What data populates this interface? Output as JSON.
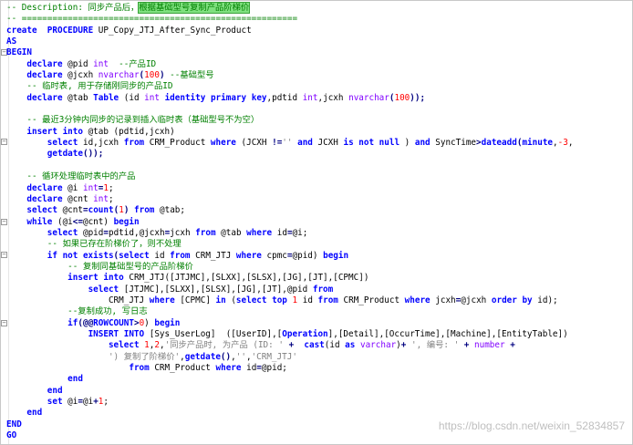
{
  "editor": {
    "watermark": "https://blog.csdn.net/weixin_52834857",
    "colors": {
      "keyword": "#0000ff",
      "comment": "#008000",
      "type": "#8000ff",
      "number": "#ff0000",
      "string": "#808080",
      "highlight": "#7fe07f"
    },
    "lines": [
      [
        [
          "c",
          "-- Description: 同步产品后，"
        ],
        [
          "c hl",
          "根据基础型号复制产品阶梯价"
        ]
      ],
      [
        [
          "c",
          "-- ======================================================"
        ]
      ],
      [
        [
          "k",
          "create"
        ],
        [
          "",
          "  "
        ],
        [
          "k",
          "PROCEDURE"
        ],
        [
          "",
          " UP_Copy_JTJ_After_Sync_Product"
        ]
      ],
      [
        [
          "k",
          "AS"
        ]
      ],
      [
        [
          "k",
          "BEGIN"
        ]
      ],
      [
        [
          "",
          "    "
        ],
        [
          "k",
          "declare"
        ],
        [
          "",
          " @pid "
        ],
        [
          "t",
          "int"
        ],
        [
          "c",
          "  --产品ID"
        ]
      ],
      [
        [
          "",
          "    "
        ],
        [
          "k",
          "declare"
        ],
        [
          "",
          " @jcxh "
        ],
        [
          "t",
          "nvarchar"
        ],
        [
          "p",
          "("
        ],
        [
          "n",
          "100"
        ],
        [
          "p",
          ")"
        ],
        [
          "c",
          " --基础型号"
        ]
      ],
      [
        [
          "",
          "    "
        ],
        [
          "c",
          "-- 临时表, 用于存储刚同步的产品ID"
        ]
      ],
      [
        [
          "",
          "    "
        ],
        [
          "k",
          "declare"
        ],
        [
          "",
          " @tab "
        ],
        [
          "k",
          "Table"
        ],
        [
          "",
          " (id "
        ],
        [
          "t",
          "int"
        ],
        [
          " ",
          ""
        ],
        [
          "k",
          " identity primary key"
        ],
        [
          "",
          ",pdtid "
        ],
        [
          "t",
          "int"
        ],
        [
          "",
          ",jcxh "
        ],
        [
          "t",
          "nvarchar"
        ],
        [
          "p",
          "("
        ],
        [
          "n",
          "100"
        ],
        [
          "p",
          "));"
        ]
      ],
      [
        [
          "",
          " "
        ]
      ],
      [
        [
          "",
          "    "
        ],
        [
          "c",
          "-- 最近3分钟内同步的记录到插入临时表（基础型号不为空）"
        ]
      ],
      [
        [
          "",
          "    "
        ],
        [
          "k",
          "insert into"
        ],
        [
          "",
          " @tab (pdtid,jcxh)"
        ]
      ],
      [
        [
          "",
          "        "
        ],
        [
          "k",
          "select"
        ],
        [
          "",
          " id,jcxh "
        ],
        [
          "k",
          "from"
        ],
        [
          "",
          " CRM_Product "
        ],
        [
          "k",
          "where"
        ],
        [
          "",
          " (JCXH "
        ],
        [
          "p",
          "!="
        ],
        [
          "s",
          "''"
        ],
        [
          "k",
          " and"
        ],
        [
          "",
          " JCXH "
        ],
        [
          "k",
          "is not null"
        ],
        [
          "",
          " ) "
        ],
        [
          "k",
          "and"
        ],
        [
          "",
          " SyncTime"
        ],
        [
          "p",
          ">"
        ],
        [
          "k",
          "dateadd"
        ],
        [
          "p",
          "("
        ],
        [
          "k",
          "minute"
        ],
        [
          "",
          ","
        ],
        [
          "n",
          "-3"
        ],
        [
          "",
          ","
        ]
      ],
      [
        [
          "",
          "        "
        ],
        [
          "k",
          "getdate"
        ],
        [
          "p",
          "());"
        ]
      ],
      [
        [
          "",
          " "
        ]
      ],
      [
        [
          "",
          "    "
        ],
        [
          "c",
          "-- 循环处理临时表中的产品"
        ]
      ],
      [
        [
          "",
          "    "
        ],
        [
          "k",
          "declare"
        ],
        [
          "",
          " @i "
        ],
        [
          "t",
          "int"
        ],
        [
          "p",
          "="
        ],
        [
          "n",
          "1"
        ],
        [
          "",
          ";"
        ]
      ],
      [
        [
          "",
          "    "
        ],
        [
          "k",
          "declare"
        ],
        [
          "",
          " @cnt "
        ],
        [
          "t",
          "int"
        ],
        [
          "",
          ";"
        ]
      ],
      [
        [
          "",
          "    "
        ],
        [
          "k",
          "select"
        ],
        [
          "",
          " @cnt"
        ],
        [
          "p",
          "="
        ],
        [
          "k",
          "count"
        ],
        [
          "p",
          "("
        ],
        [
          "n",
          "1"
        ],
        [
          "p",
          ")"
        ],
        [
          "k",
          " from"
        ],
        [
          "",
          " @tab;"
        ]
      ],
      [
        [
          "",
          "    "
        ],
        [
          "k",
          "while"
        ],
        [
          "",
          " (@i"
        ],
        [
          "p",
          "<="
        ],
        [
          "",
          "@cnt) "
        ],
        [
          "k",
          "begin"
        ]
      ],
      [
        [
          "",
          "        "
        ],
        [
          "k",
          "select"
        ],
        [
          "",
          " @pid"
        ],
        [
          "p",
          "="
        ],
        [
          "",
          "pdtid,@jcxh"
        ],
        [
          "p",
          "="
        ],
        [
          "",
          "jcxh "
        ],
        [
          "k",
          "from"
        ],
        [
          "",
          " @tab "
        ],
        [
          "k",
          "where"
        ],
        [
          "",
          " id"
        ],
        [
          "p",
          "="
        ],
        [
          "",
          "@i;"
        ]
      ],
      [
        [
          "",
          "        "
        ],
        [
          "c",
          "-- 如果已存在阶梯价了，则不处理"
        ]
      ],
      [
        [
          "",
          "        "
        ],
        [
          "k",
          "if not exists"
        ],
        [
          "p",
          "("
        ],
        [
          "k",
          "select"
        ],
        [
          "",
          " id "
        ],
        [
          "k",
          "from"
        ],
        [
          "",
          " CRM_JTJ "
        ],
        [
          "k",
          "where"
        ],
        [
          "",
          " cpmc"
        ],
        [
          "p",
          "="
        ],
        [
          "",
          "@pid) "
        ],
        [
          "k",
          "begin"
        ]
      ],
      [
        [
          "",
          "            "
        ],
        [
          "c",
          "-- 复制同基础型号的产品阶梯价"
        ]
      ],
      [
        [
          "",
          "            "
        ],
        [
          "k",
          "insert into"
        ],
        [
          "",
          " CRM_JTJ([JTJMC],[SLXX],[SLSX],[JG],[JT],[CPMC])"
        ]
      ],
      [
        [
          "",
          "                "
        ],
        [
          "k",
          "select"
        ],
        [
          "",
          " [JTJMC],[SLXX],[SLSX],[JG],[JT],@pid "
        ],
        [
          "k",
          "from"
        ]
      ],
      [
        [
          "",
          "                    CRM_JTJ "
        ],
        [
          "k",
          "where"
        ],
        [
          "",
          " [CPMC] "
        ],
        [
          "k",
          "in"
        ],
        [
          "",
          " ("
        ],
        [
          "k",
          "select top"
        ],
        [
          "",
          " "
        ],
        [
          "n",
          "1"
        ],
        [
          "",
          " id "
        ],
        [
          "k",
          "from"
        ],
        [
          "",
          " CRM_Product "
        ],
        [
          "k",
          "where"
        ],
        [
          "",
          " jcxh"
        ],
        [
          "p",
          "="
        ],
        [
          "",
          "@jcxh "
        ],
        [
          "k",
          "order by"
        ],
        [
          "",
          " id);"
        ]
      ],
      [
        [
          "",
          "            "
        ],
        [
          "c",
          "--复制成功, 写日志"
        ]
      ],
      [
        [
          "",
          "            "
        ],
        [
          "k",
          "if"
        ],
        [
          "p",
          "(@@"
        ],
        [
          "k",
          "ROWCOUNT"
        ],
        [
          "p",
          ">"
        ],
        [
          "n",
          "0"
        ],
        [
          "",
          ") "
        ],
        [
          "k",
          "begin"
        ]
      ],
      [
        [
          "",
          "                "
        ],
        [
          "k",
          "INSERT INTO"
        ],
        [
          "",
          " [Sys_UserLog]  ([UserID],["
        ],
        [
          "k",
          "Operation"
        ],
        [
          "",
          "],[Detail],[OccurTime],[Machine],[EntityTable])"
        ]
      ],
      [
        [
          "",
          "                    "
        ],
        [
          "k",
          "select"
        ],
        [
          "",
          " "
        ],
        [
          "n",
          "1"
        ],
        [
          "",
          ","
        ],
        [
          "n",
          "2"
        ],
        [
          "",
          ","
        ],
        [
          "s",
          "'同步产品时, 为产品 (ID: '"
        ],
        [
          "",
          " "
        ],
        [
          "p",
          "+"
        ],
        [
          "",
          " "
        ],
        [
          "k",
          " cast"
        ],
        [
          "",
          "(id "
        ],
        [
          "k",
          "as"
        ],
        [
          "",
          " "
        ],
        [
          "t",
          "varchar"
        ],
        [
          "",
          ")"
        ],
        [
          "p",
          "+"
        ],
        [
          "",
          " "
        ],
        [
          "s",
          "', 编号: '"
        ],
        [
          "",
          " "
        ],
        [
          "p",
          "+"
        ],
        [
          "",
          " "
        ],
        [
          "t",
          "number"
        ],
        [
          "",
          " "
        ],
        [
          "p",
          "+"
        ]
      ],
      [
        [
          "",
          "                    "
        ],
        [
          "s",
          "') 复制了阶梯价'"
        ],
        [
          "",
          ","
        ],
        [
          "k",
          "getdate"
        ],
        [
          "p",
          "()"
        ],
        [
          "",
          ","
        ],
        [
          "s",
          "''"
        ],
        [
          "",
          ","
        ],
        [
          "s",
          "'CRM_JTJ'"
        ]
      ],
      [
        [
          "",
          "                        "
        ],
        [
          "k",
          "from"
        ],
        [
          "",
          " CRM_Product "
        ],
        [
          "k",
          "where"
        ],
        [
          "",
          " id"
        ],
        [
          "p",
          "="
        ],
        [
          "",
          "@pid;"
        ]
      ],
      [
        [
          "",
          "            "
        ],
        [
          "k",
          "end"
        ]
      ],
      [
        [
          "",
          "        "
        ],
        [
          "k",
          "end"
        ]
      ],
      [
        [
          "",
          "        "
        ],
        [
          "k",
          "set"
        ],
        [
          "",
          " @i"
        ],
        [
          "p",
          "="
        ],
        [
          "",
          "@i"
        ],
        [
          "p",
          "+"
        ],
        [
          "n",
          "1"
        ],
        [
          "",
          ";"
        ]
      ],
      [
        [
          "",
          "    "
        ],
        [
          "k",
          "end"
        ]
      ],
      [
        [
          "k",
          "END"
        ]
      ],
      [
        [
          "k",
          "GO"
        ]
      ]
    ]
  }
}
